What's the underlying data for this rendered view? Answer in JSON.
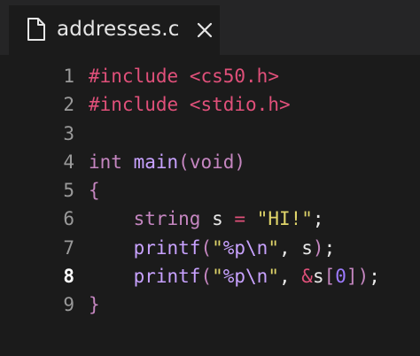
{
  "tab": {
    "title": "addresses.c",
    "close_label": "×"
  },
  "lines": [
    {
      "number": "1",
      "tokens": [
        [
          "kw",
          "#include"
        ],
        [
          "plain",
          " "
        ],
        [
          "kw",
          "<cs50.h>"
        ]
      ]
    },
    {
      "number": "2",
      "tokens": [
        [
          "kw",
          "#include"
        ],
        [
          "plain",
          " "
        ],
        [
          "kw",
          "<stdio.h>"
        ]
      ]
    },
    {
      "number": "3",
      "tokens": []
    },
    {
      "number": "4",
      "tokens": [
        [
          "type",
          "int"
        ],
        [
          "plain",
          " "
        ],
        [
          "fn",
          "main"
        ],
        [
          "brace",
          "("
        ],
        [
          "type",
          "void"
        ],
        [
          "brace",
          ")"
        ]
      ]
    },
    {
      "number": "5",
      "tokens": [
        [
          "brace",
          "{"
        ]
      ]
    },
    {
      "number": "6",
      "tokens": [
        [
          "plain",
          "    "
        ],
        [
          "type",
          "string"
        ],
        [
          "plain",
          " s "
        ],
        [
          "kw",
          "="
        ],
        [
          "plain",
          " "
        ],
        [
          "str",
          "\"HI!\""
        ],
        [
          "plain",
          ";"
        ]
      ]
    },
    {
      "number": "7",
      "tokens": [
        [
          "plain",
          "    "
        ],
        [
          "fn",
          "printf"
        ],
        [
          "brace",
          "("
        ],
        [
          "str",
          "\""
        ],
        [
          "esc",
          "%p\\n"
        ],
        [
          "str",
          "\""
        ],
        [
          "plain",
          ", s"
        ],
        [
          "brace",
          ")"
        ],
        [
          "plain",
          ";"
        ]
      ]
    },
    {
      "number": "8",
      "tokens": [
        [
          "plain",
          "    "
        ],
        [
          "fn",
          "printf"
        ],
        [
          "brace",
          "("
        ],
        [
          "str",
          "\""
        ],
        [
          "esc",
          "%p\\n"
        ],
        [
          "str",
          "\""
        ],
        [
          "plain",
          ", "
        ],
        [
          "kw",
          "&"
        ],
        [
          "plain",
          "s"
        ],
        [
          "brace",
          "["
        ],
        [
          "num",
          "0"
        ],
        [
          "brace",
          "]"
        ],
        [
          "brace",
          ")"
        ],
        [
          "plain",
          ";"
        ]
      ]
    },
    {
      "number": "9",
      "tokens": [
        [
          "brace",
          "}"
        ]
      ]
    }
  ],
  "active_line": "8",
  "colors": {
    "background": "#1b1b1b",
    "keyword": "#e0507a",
    "type": "#c586c0",
    "function": "#c8a2ff",
    "string": "#e0d56a"
  }
}
